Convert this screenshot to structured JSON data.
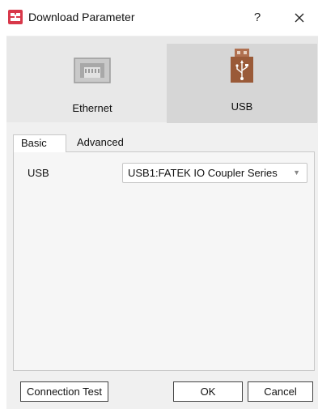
{
  "window": {
    "title": "Download Parameter",
    "help_label": "?",
    "icon": "app-icon"
  },
  "connection_types": [
    {
      "label": "Ethernet",
      "icon": "ethernet-icon",
      "selected": false
    },
    {
      "label": "USB",
      "icon": "usb-icon",
      "selected": true
    }
  ],
  "tabs": [
    {
      "label": "Basic",
      "active": true
    },
    {
      "label": "Advanced",
      "active": false
    }
  ],
  "basic": {
    "usb_label": "USB",
    "usb_value": "USB1:FATEK IO Coupler Series"
  },
  "buttons": {
    "connection_test": "Connection Test",
    "ok": "OK",
    "cancel": "Cancel"
  },
  "colors": {
    "app_icon_red": "#d8384a",
    "usb_brown": "#9a5a38",
    "selected_bg": "#d6d6d6"
  }
}
